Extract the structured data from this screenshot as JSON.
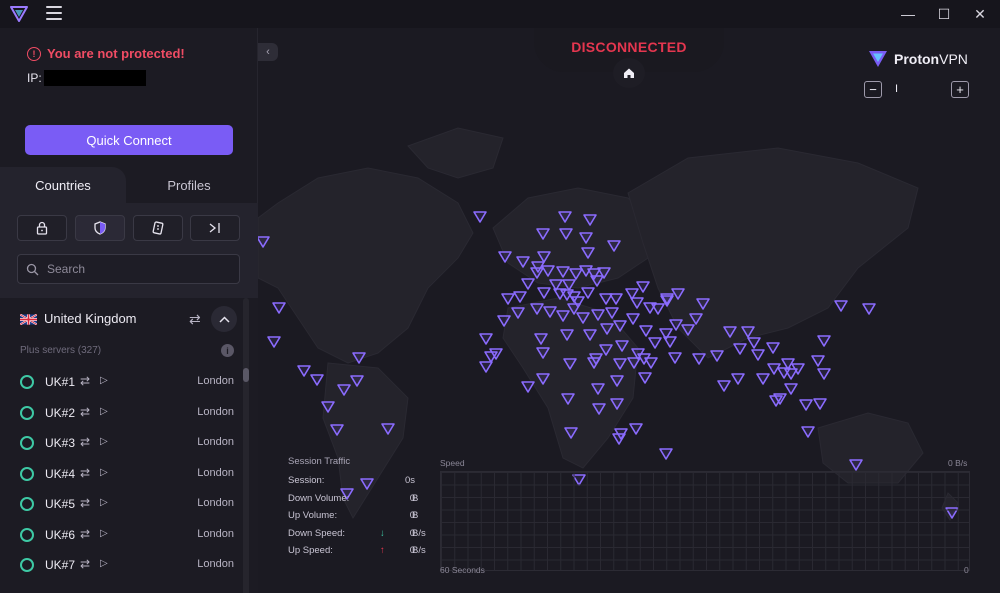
{
  "window": {
    "minimize": "—",
    "maximize": "☐",
    "close": "✕"
  },
  "sidebar": {
    "warning": "You are not protected!",
    "ip_label": "IP:",
    "quick_connect": "Quick Connect",
    "tabs": [
      "Countries",
      "Profiles"
    ],
    "search_placeholder": "Search",
    "country": "United Kingdom",
    "plus_servers": "Plus servers (327)",
    "servers": [
      {
        "name": "UK#1",
        "location": "London"
      },
      {
        "name": "UK#2",
        "location": "London"
      },
      {
        "name": "UK#3",
        "location": "London"
      },
      {
        "name": "UK#4",
        "location": "London"
      },
      {
        "name": "UK#5",
        "location": "London"
      },
      {
        "name": "UK#6",
        "location": "London"
      },
      {
        "name": "UK#7",
        "location": "London"
      }
    ]
  },
  "main": {
    "status": "DISCONNECTED",
    "brand_proton": "Proton",
    "brand_vpn": "VPN",
    "zoom_minus": "−",
    "zoom_plus": "+",
    "zoom_level": "I",
    "traffic": {
      "title": "Session Traffic",
      "rows": [
        {
          "label": "Session:",
          "value": "0s",
          "unit": ""
        },
        {
          "label": "Down Volume:",
          "value": "0",
          "unit": "B"
        },
        {
          "label": "Up Volume:",
          "value": "0",
          "unit": "B"
        },
        {
          "label": "Down Speed:",
          "value": "0",
          "unit": "B/s"
        },
        {
          "label": "Up Speed:",
          "value": "0",
          "unit": "B/s"
        }
      ]
    },
    "graph": {
      "title": "Speed",
      "top_right": "0 B/s",
      "bottom_left": "60 Seconds",
      "bottom_right": "0"
    }
  },
  "colors": {
    "accent": "#7a5cf5",
    "danger": "#e5364f",
    "online": "#3ec9a5",
    "server_pin": "#8b6cff"
  }
}
